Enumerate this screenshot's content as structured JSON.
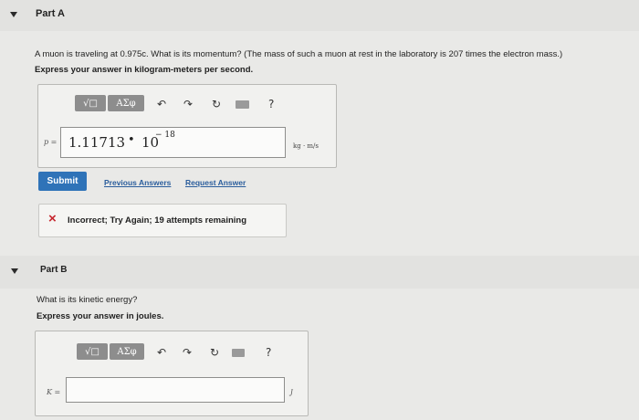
{
  "part_a": {
    "title": "Part A",
    "question": "A muon is traveling at 0.975c. What is its momentum? (The mass of such a muon at rest in the laboratory is 207 times the electron mass.)",
    "instruction": "Express your answer in kilogram-meters per second.",
    "toolbar": {
      "matrix_label": "√□",
      "greek_label": "ΑΣφ",
      "help_label": "?"
    },
    "variable": "p =",
    "answer_mantissa": "1.11713",
    "answer_times": "•",
    "answer_base": "10",
    "answer_exponent": "− 18",
    "unit": "kg · m/s",
    "submit_label": "Submit",
    "previous_answers_label": "Previous Answers",
    "request_answer_label": "Request Answer",
    "feedback_icon": "×",
    "feedback_text": "Incorrect; Try Again; 19 attempts remaining"
  },
  "part_b": {
    "title": "Part B",
    "question": "What is its kinetic energy?",
    "instruction": "Express your answer in joules.",
    "toolbar": {
      "matrix_label": "√□",
      "greek_label": "ΑΣφ",
      "help_label": "?"
    },
    "variable": "K =",
    "answer_value": "",
    "unit": "J"
  },
  "colors": {
    "submit_blue": "#2f73b8",
    "link_blue": "#2a5d9c",
    "error_red": "#c6262e"
  }
}
